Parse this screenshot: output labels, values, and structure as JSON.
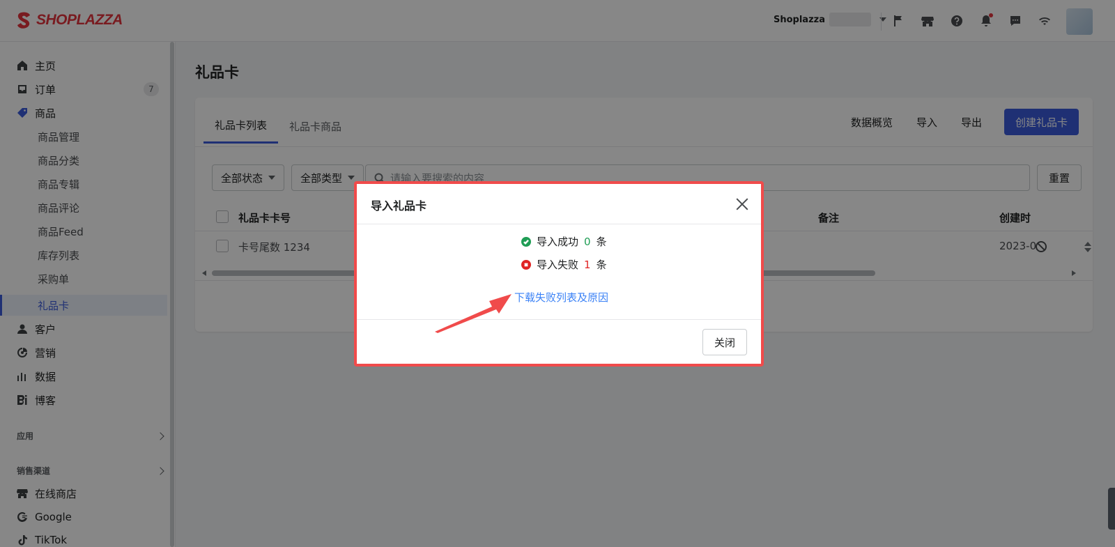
{
  "brand": {
    "logo_text": "SHOPLAZZA",
    "logo_color": "#e4343e"
  },
  "topbar": {
    "store_name": "Shoplazza",
    "icons": [
      "flag-icon",
      "store-icon",
      "help-icon",
      "bell-icon",
      "chat-icon",
      "wifi-icon"
    ]
  },
  "sidebar": {
    "items": [
      {
        "label": "主页",
        "icon": "home-icon"
      },
      {
        "label": "订单",
        "icon": "inbox-icon",
        "badge": "7"
      },
      {
        "label": "商品",
        "icon": "tag-icon"
      },
      {
        "label": "客户",
        "icon": "person-icon"
      },
      {
        "label": "营销",
        "icon": "marketing-icon"
      },
      {
        "label": "数据",
        "icon": "chart-icon"
      },
      {
        "label": "博客",
        "icon": "blog-icon"
      }
    ],
    "product_sub": [
      "商品管理",
      "商品分类",
      "商品专辑",
      "商品评论",
      "商品Feed",
      "库存列表",
      "采购单",
      "礼品卡"
    ],
    "active_sub": "礼品卡",
    "sections": {
      "apps": "应用",
      "channels": "销售渠道"
    },
    "channels": [
      {
        "label": "在线商店",
        "icon": "store-icon"
      },
      {
        "label": "Google",
        "icon": "google-icon"
      },
      {
        "label": "TikTok",
        "icon": "tiktok-icon"
      }
    ]
  },
  "main": {
    "title": "礼品卡",
    "tabs": [
      {
        "label": "礼品卡列表",
        "active": true
      },
      {
        "label": "礼品卡商品",
        "active": false
      }
    ],
    "actions": {
      "overview": "数据概览",
      "import": "导入",
      "export": "导出",
      "create": "创建礼品卡"
    },
    "filters": {
      "status": "全部状态",
      "type": "全部类型",
      "search_placeholder": "请输入要搜索的内容",
      "reset": "重置"
    },
    "table": {
      "headers": {
        "card_no": "礼品卡卡号",
        "note": "备注",
        "created": "创建时"
      },
      "rows": [
        {
          "card_no": "卡号尾数 1234",
          "created": "2023-0"
        }
      ]
    }
  },
  "modal": {
    "title": "导入礼品卡",
    "success_prefix": "导入成功",
    "success_count": "0",
    "fail_prefix": "导入失败",
    "fail_count": "1",
    "unit": "条",
    "download_link": "下载失败列表及原因",
    "close": "关闭",
    "highlight_color": "#f04b4b"
  },
  "colors": {
    "accent": "#3b5bdb",
    "success": "#1f9d55",
    "error": "#e02424",
    "link": "#3b82f6"
  }
}
